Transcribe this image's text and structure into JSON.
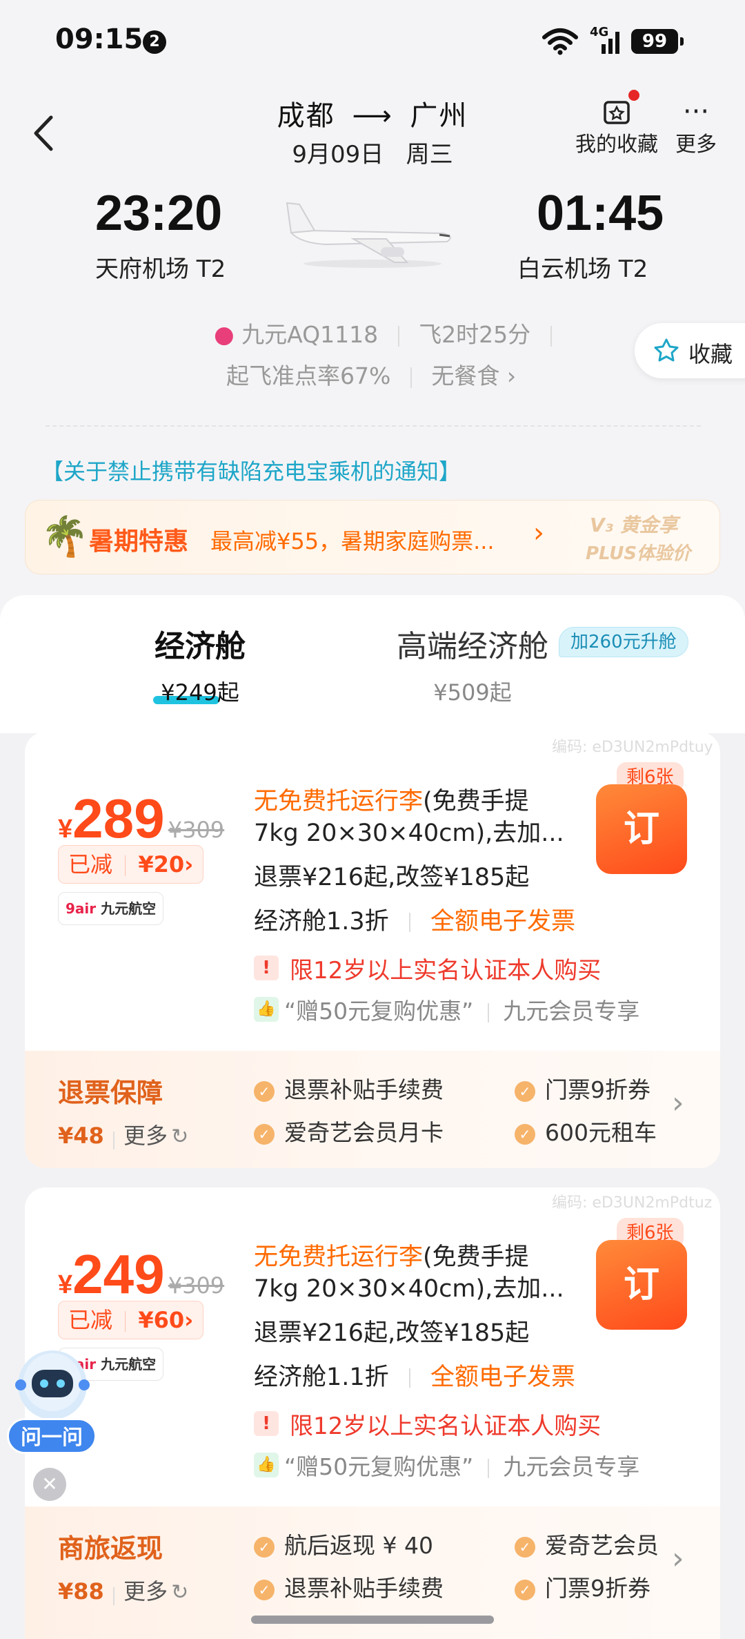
{
  "status_bar": {
    "time": "09:15",
    "notif_count": "2",
    "network": "4G",
    "battery": "99"
  },
  "header": {
    "from": "成都",
    "to": "广州",
    "date": "9月09日",
    "weekday": "周三",
    "favorites_label": "我的收藏",
    "more_label": "更多"
  },
  "flight": {
    "dep_time": "23:20",
    "dep_airport": "天府机场 T2",
    "arr_time": "01:45",
    "arr_airport": "白云机场 T2",
    "airline_flight": "九元AQ1118",
    "duration": "飞2时25分",
    "ontime_rate": "起飞准点率67%",
    "meal": "无餐食"
  },
  "collect_button": "收藏",
  "notice": "【关于禁止携带有缺陷充电宝乘机的通知】",
  "promo": {
    "title": "暑期特惠",
    "desc": "最高减¥55，暑期家庭购票...",
    "badge_line1": "黄金享",
    "badge_line2": "PLUS体验价"
  },
  "tabs": [
    {
      "name": "经济舱",
      "price": "¥249起"
    },
    {
      "name": "高端经济舱",
      "price": "¥509起",
      "upgrade": "加260元升舱"
    }
  ],
  "offers": [
    {
      "code": "编码: eD3UN2mPdtuy",
      "currency": "¥",
      "price": "289",
      "orig_price": "¥309",
      "cut_label": "已减",
      "cut_amount": "¥20",
      "airline_logo": "9air 九元航空",
      "baggage_highlight": "无免费托运行李",
      "baggage_rest": "(免费手提",
      "baggage_line2": "7kg 20×30×40cm),去加...",
      "refund": "退票¥216起,改签¥185起",
      "cabin": "经济舱1.3折",
      "invoice": "全额电子发票",
      "restriction": "限12岁以上实名认证本人购买",
      "coupon": "“赠50元复购优惠”",
      "member": "九元会员专享",
      "remain": "剩6张",
      "book": "订",
      "perk": {
        "title": "退票保障",
        "price": "¥48",
        "more": "更多",
        "items": [
          "退票补贴手续费",
          "门票9折券",
          "爱奇艺会员月卡",
          "600元租车"
        ]
      }
    },
    {
      "code": "编码: eD3UN2mPdtuz",
      "currency": "¥",
      "price": "249",
      "orig_price": "¥309",
      "cut_label": "已减",
      "cut_amount": "¥60",
      "airline_logo": "9air 九元航空",
      "baggage_highlight": "无免费托运行李",
      "baggage_rest": "(免费手提",
      "baggage_line2": "7kg 20×30×40cm),去加...",
      "refund": "退票¥216起,改签¥185起",
      "cabin": "经济舱1.1折",
      "invoice": "全额电子发票",
      "restriction": "限12岁以上实名认证本人购买",
      "coupon": "“赠50元复购优惠”",
      "member": "九元会员专享",
      "remain": "剩6张",
      "book": "订",
      "perk": {
        "title": "商旅返现",
        "price": "¥88",
        "more": "更多",
        "items": [
          "航后返现 ¥ 40",
          "爱奇艺会员",
          "退票补贴手续费",
          "门票9折券"
        ]
      }
    }
  ],
  "assistant": {
    "label": "问一问"
  },
  "colors": {
    "accent": "#ff4a1a",
    "teal": "#1ea6c8",
    "orange": "#ff6a00"
  }
}
